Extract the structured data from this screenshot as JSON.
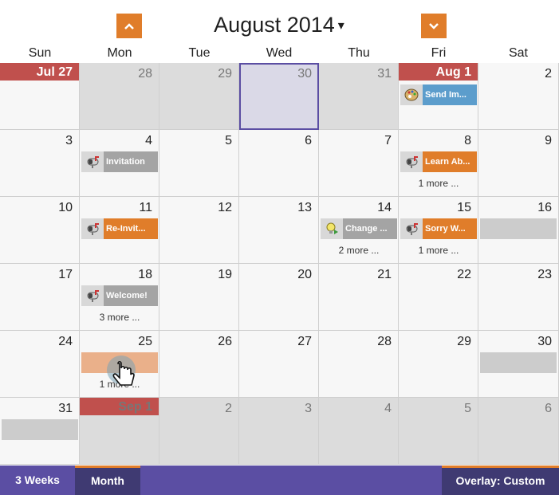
{
  "header": {
    "title": "August 2014",
    "dropdown_caret": "▾",
    "prev_icon": "chevron-up-icon",
    "next_icon": "chevron-down-icon"
  },
  "weekdays": [
    "Sun",
    "Mon",
    "Tue",
    "Wed",
    "Thu",
    "Fri",
    "Sat"
  ],
  "weeks": [
    [
      {
        "day": "Jul 27",
        "banner": true
      },
      {
        "day": "28",
        "other": true
      },
      {
        "day": "29",
        "other": true
      },
      {
        "day": "30",
        "other": true,
        "selected": true
      },
      {
        "day": "31",
        "other": true
      },
      {
        "day": "Aug 1",
        "banner": true,
        "events": [
          {
            "label": "Send Im...",
            "color": "blue",
            "icon": "palette-icon"
          }
        ]
      },
      {
        "day": "2"
      }
    ],
    [
      {
        "day": "3"
      },
      {
        "day": "4",
        "events": [
          {
            "label": "Invitation",
            "color": "gray",
            "icon": "mailbox-icon"
          }
        ]
      },
      {
        "day": "5"
      },
      {
        "day": "6"
      },
      {
        "day": "7"
      },
      {
        "day": "8",
        "events": [
          {
            "label": "Learn Ab...",
            "color": "orange",
            "icon": "mailbox-icon"
          }
        ],
        "more": "1 more ..."
      },
      {
        "day": "9"
      }
    ],
    [
      {
        "day": "10"
      },
      {
        "day": "11",
        "events": [
          {
            "label": "Re-Invit...",
            "color": "orange",
            "icon": "mailbox-icon"
          }
        ]
      },
      {
        "day": "12"
      },
      {
        "day": "13"
      },
      {
        "day": "14",
        "events": [
          {
            "label": "Change ...",
            "color": "gray",
            "icon": "lightbulb-icon"
          }
        ],
        "more": "2 more ..."
      },
      {
        "day": "15",
        "events": [
          {
            "label": "Sorry W...",
            "color": "orange",
            "icon": "mailbox-icon"
          }
        ],
        "more": "1 more ..."
      },
      {
        "day": "16",
        "placeholder": true
      }
    ],
    [
      {
        "day": "17"
      },
      {
        "day": "18",
        "events": [
          {
            "label": "Welcome!",
            "color": "gray",
            "icon": "mailbox-icon"
          }
        ],
        "more": "3 more ..."
      },
      {
        "day": "19"
      },
      {
        "day": "20"
      },
      {
        "day": "21"
      },
      {
        "day": "22"
      },
      {
        "day": "23"
      }
    ],
    [
      {
        "day": "24"
      },
      {
        "day": "25",
        "dragging": true,
        "more": "1 more ..."
      },
      {
        "day": "26"
      },
      {
        "day": "27"
      },
      {
        "day": "28"
      },
      {
        "day": "29"
      },
      {
        "day": "30",
        "placeholder": true
      }
    ],
    [
      {
        "day": "31",
        "placeholder": true
      },
      {
        "day": "Sep 1",
        "banner": true,
        "other": true
      },
      {
        "day": "2",
        "other": true
      },
      {
        "day": "3",
        "other": true
      },
      {
        "day": "4",
        "other": true
      },
      {
        "day": "5",
        "other": true
      },
      {
        "day": "6",
        "other": true
      }
    ]
  ],
  "footer": {
    "tab_3weeks": "3 Weeks",
    "tab_month": "Month",
    "overlay": "Overlay: Custom"
  },
  "colors": {
    "accent_orange": "#e07d2a",
    "banner_red": "#c0504d",
    "footer_purple": "#5b4ea3",
    "event_blue": "#5c9dcc"
  }
}
